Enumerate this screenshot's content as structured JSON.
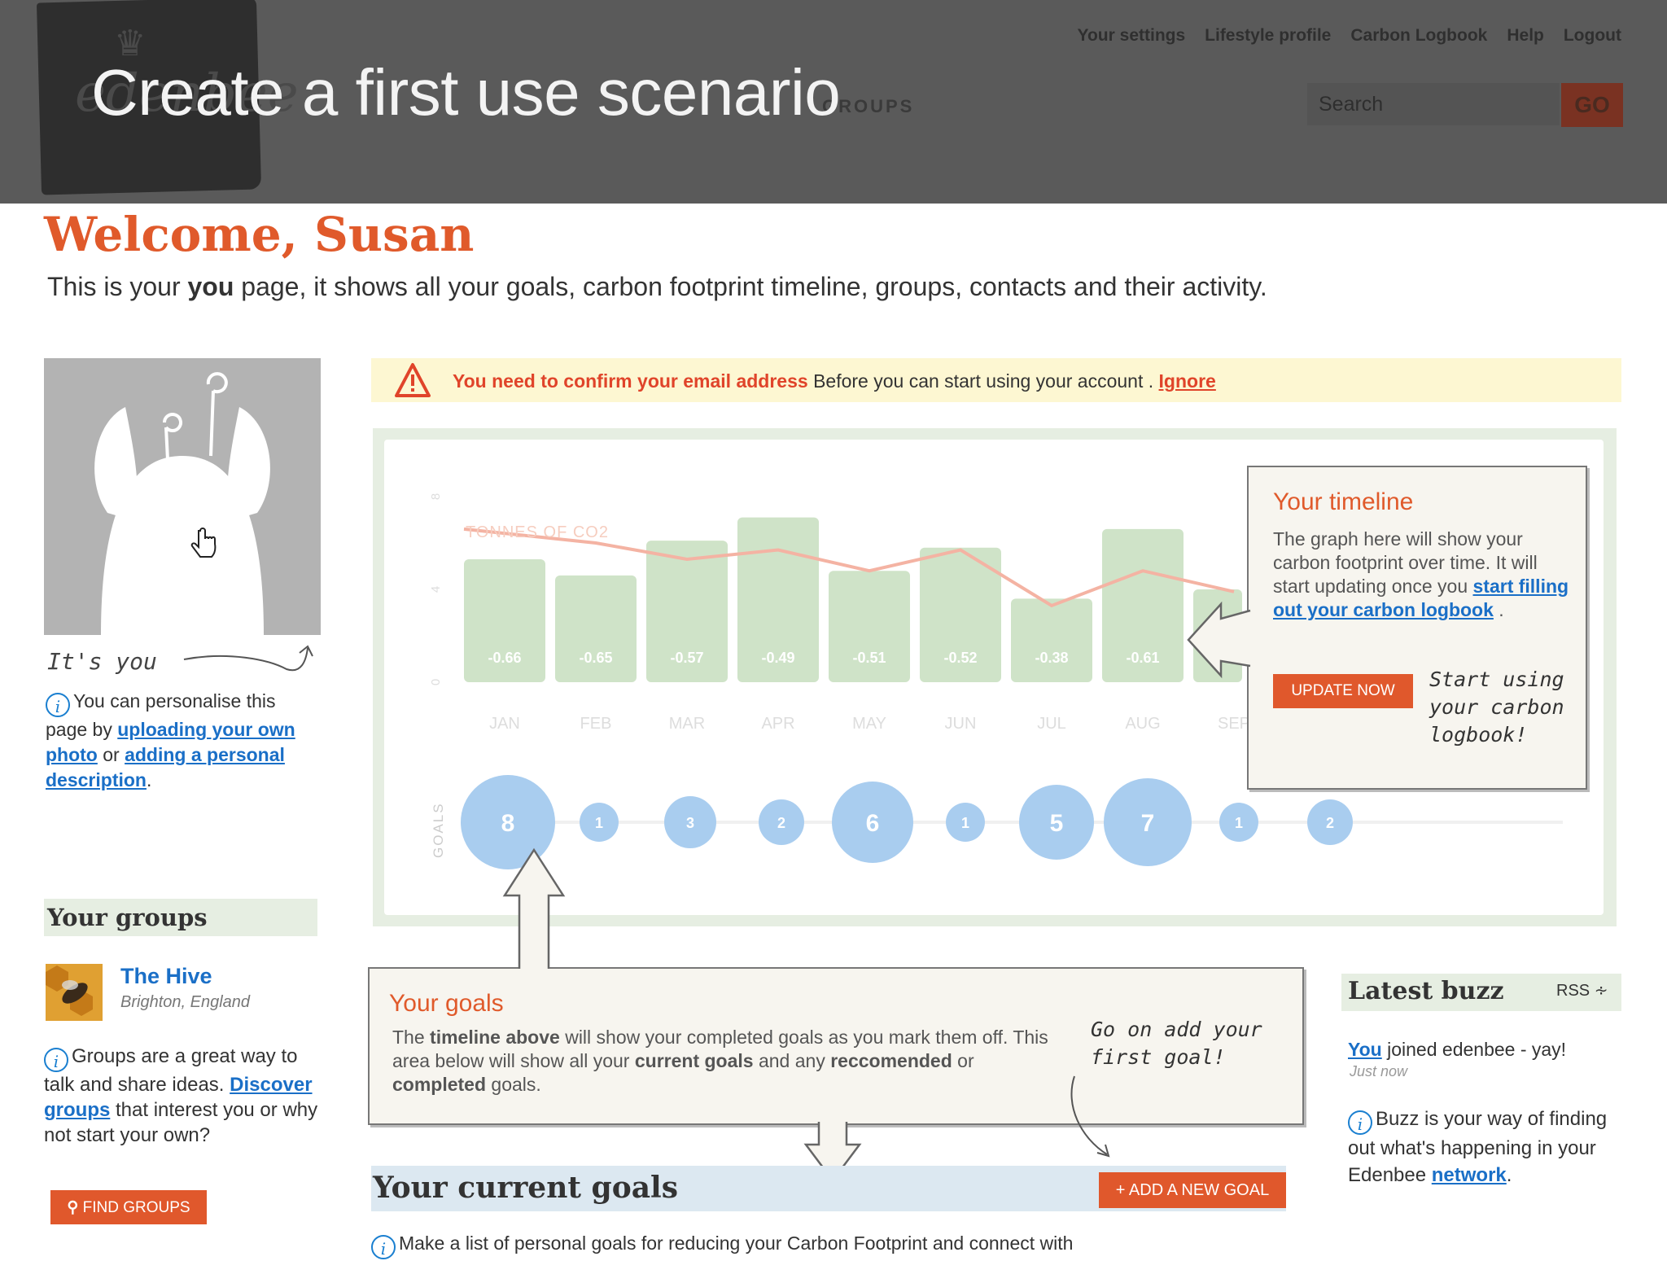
{
  "slide_title": "Create a first use scenario",
  "header": {
    "logo_text": "edenbee",
    "nav_faded": "GROUPS",
    "top_links": [
      "Your settings",
      "Lifestyle profile",
      "Carbon Logbook",
      "Help",
      "Logout"
    ],
    "search_placeholder": "Search",
    "go_label": "GO"
  },
  "welcome": {
    "title": "Welcome, Susan",
    "intro_prefix": "This is your ",
    "intro_bold": "you",
    "intro_suffix": " page, it shows all your goals, carbon footprint timeline, groups, contacts and their activity."
  },
  "avatar": {
    "caption": "It's you",
    "text_1": "You can personalise this page by ",
    "link_1": "uploading your own photo",
    "text_2": " or ",
    "link_2": "adding a personal description",
    "text_3": "."
  },
  "alert": {
    "strong": "You need to confirm your email address",
    "text": " Before you can start using your account . ",
    "link": "Ignore"
  },
  "chart_data": {
    "type": "bar",
    "ylabel": "TONNES OF CO2",
    "y_ticks": [
      "0",
      "4",
      "8"
    ],
    "ylim": [
      0,
      8
    ],
    "categories": [
      "JAN",
      "FEB",
      "MAR",
      "APR",
      "MAY",
      "JUN",
      "JUL",
      "AUG",
      "SEP"
    ],
    "bar_heights": [
      5.3,
      4.6,
      6.1,
      7.1,
      4.8,
      5.8,
      3.6,
      6.6,
      4.0
    ],
    "value_labels": [
      "-0.66",
      "-0.65",
      "-0.57",
      "-0.49",
      "-0.51",
      "-0.52",
      "-0.38",
      "-0.61",
      ""
    ],
    "line_values": [
      6.6,
      6.0,
      5.3,
      5.7,
      4.8,
      5.7,
      3.3,
      4.8,
      3.9
    ],
    "goals_axis_label": "GOALS",
    "goals": [
      8,
      1,
      3,
      2,
      6,
      1,
      5,
      7,
      1,
      2
    ],
    "colors": {
      "bar": "#cfe3c8",
      "line": "#f4b3a3",
      "goal": "#a9cdef",
      "tick": "#dddddd"
    }
  },
  "timeline_callout": {
    "title": "Your timeline",
    "body": "The graph here will show your carbon footprint over time. It will start updating once you ",
    "link": "start filling out your carbon logbook",
    "body_end": " .",
    "button": "UPDATE NOW",
    "hand_note": "Start using your carbon logbook!"
  },
  "goals_callout": {
    "title": "Your goals",
    "p1": "The ",
    "b1": "timeline above",
    "p2": " will show your completed goals as you mark them off. This area below will show all your ",
    "b2": "current goals",
    "p3": " and any ",
    "b3": "reccomended",
    "p4": " or ",
    "b4": "completed",
    "p5": " goals.",
    "hand_note": "Go on add your first goal!"
  },
  "groups": {
    "title": "Your groups",
    "group_name": "The Hive",
    "group_location": "Brighton, England",
    "info_1": "Groups are a great way to talk and share ideas. ",
    "info_link": "Discover groups",
    "info_2": " that interest you or why not start your own?",
    "button": "FIND GROUPS"
  },
  "current_goals": {
    "title": "Your current goals",
    "button": "+ ADD A NEW GOAL",
    "text": "Make a list of personal goals for reducing your Carbon Footprint and connect with"
  },
  "buzz": {
    "title": "Latest buzz",
    "rss": "RSS",
    "item_link": "You",
    "item_text": " joined edenbee - yay!",
    "item_time": "Just now",
    "info_1": "Buzz is your way of finding out what's happening in your Edenbee ",
    "info_link": "network",
    "info_2": "."
  }
}
